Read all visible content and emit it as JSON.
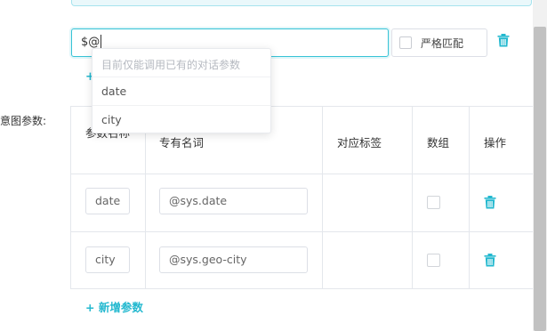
{
  "colors": {
    "accent": "#22b8cf",
    "border": "#e4e7ec",
    "focus_border": "#38c3d6"
  },
  "expression": {
    "value": "$@"
  },
  "strict_match": {
    "label": "严格匹配",
    "checked": false
  },
  "add_expression_label": "+",
  "intent_params_label": "意图参数:",
  "autocomplete": {
    "hint": "目前仅能调用已有的对话参数",
    "options": [
      "date",
      "city"
    ]
  },
  "table": {
    "headers": {
      "param_name": "参数名称",
      "entity": "专有名词",
      "tag": "对应标签",
      "is_array": "数组",
      "actions": "操作"
    },
    "rows": [
      {
        "name": "date",
        "entity": "@sys.date",
        "tag": "",
        "is_array": false
      },
      {
        "name": "city",
        "entity": "@sys.geo-city",
        "tag": "",
        "is_array": false
      }
    ]
  },
  "add_param_label": "+ 新增参数",
  "icons": {
    "delete": "trash-icon"
  }
}
